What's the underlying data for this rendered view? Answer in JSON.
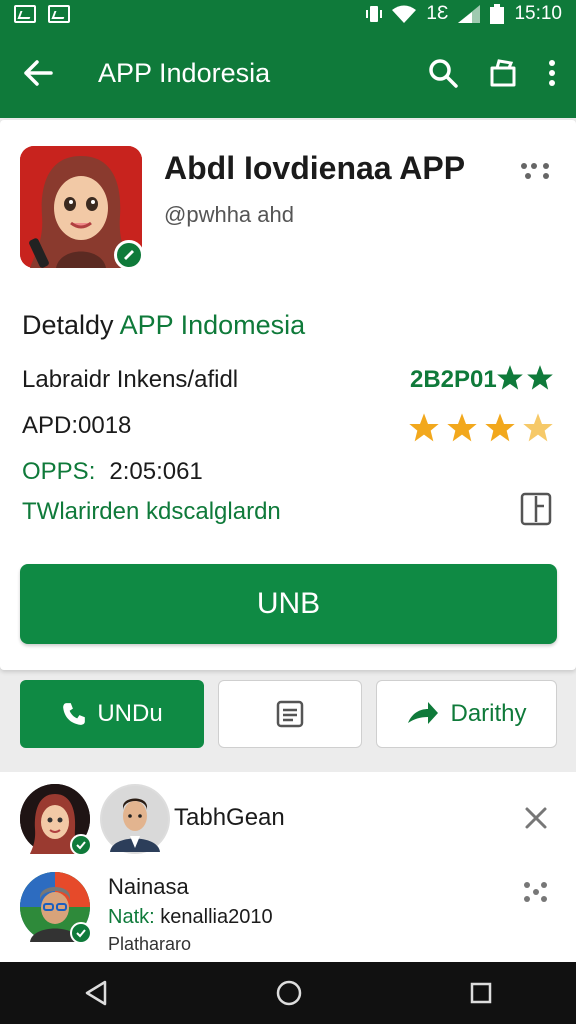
{
  "status_bar": {
    "time": "15:10",
    "network": "1Ɛ"
  },
  "app_bar": {
    "title": "APP Indoresia"
  },
  "profile": {
    "name": "Abdl Iovdienaa APP",
    "handle": "@pwhha ahd"
  },
  "details": {
    "heading_prefix": "Detaldy",
    "heading_highlight": "APP Indomesia",
    "row1": "Labraidr Inkens/afidl",
    "rating_text": "2B2P01",
    "row2": "APD:0018",
    "row3_label": "OPPS:",
    "row3_value": "2:05:061",
    "row4": "TWlarirden kdscalglardn",
    "star_rating": 3.5
  },
  "primary_button": {
    "label": "UNB"
  },
  "actions": {
    "call_label": "UNDu",
    "share_label": "Darithy"
  },
  "list": {
    "item1_name": "TabhGean",
    "item2_name": "Nainasa",
    "item2_line2_label": "Natk:",
    "item2_line2_value": "kenallia2010",
    "item2_line3": "Plathararo"
  },
  "colors": {
    "primary": "#0f7a3a",
    "star": "#f2a81d"
  }
}
